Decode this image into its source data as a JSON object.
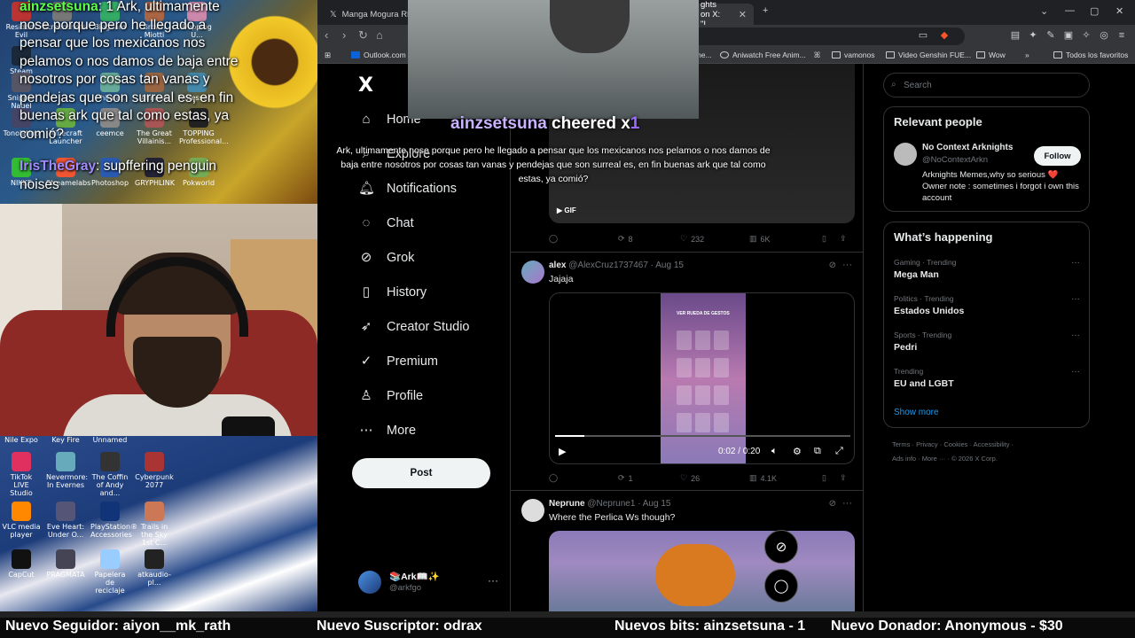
{
  "stream_chat": [
    {
      "user": "ainzsetsuna",
      "sep": ":",
      "prefix_badge": "1",
      "text": "Ark, ultimamente nose porque pero he llegado a pensar que los mexicanos nos pelamos o nos damos de baja entre nosotros por cosas tan vanas y pendejas que son surreal es, en fin buenas ark que tal como estas, ya comió?"
    },
    {
      "user": "IrisTheGray",
      "sep": ":",
      "text": "supffering penguin noises"
    }
  ],
  "desktop_icons_top": [
    "Resident Evil",
    "Screenshots",
    "Bingham",
    "Brown Miotti",
    "Dopping U...",
    "Steam",
    "Snipper Nagel",
    "Phineas",
    "Almond",
    "Professor...",
    "Tonolatino",
    "Minecraft Launcher",
    "ceemce",
    "The Great Villainis...",
    "TOPPING Professional...",
    "NIKKE",
    "Streamelabs",
    "Photoshop",
    "GRYPHLINK",
    "Pokworld"
  ],
  "desktop_icons_bottom": [
    "Nile Expo",
    "Key Fire",
    "Unnamed",
    "TikTok LIVE Studio",
    "Nevermore: In Evernes",
    "The Coffin of Andy and...",
    "Cyberpunk 2077",
    "VLC media player",
    "Eve Heart: Under O...",
    "PlayStation® Accessories",
    "Trails in the Sky 1st C...",
    "CapCut",
    "PRAGMATA",
    "Papelera de reciclaje",
    "atkaudio-pl..."
  ],
  "browser": {
    "tabs": [
      {
        "title": "Manga Mogura RE (A",
        "active": false
      },
      {
        "title": "ghts on X: \"I",
        "active": true
      }
    ],
    "window_controls": [
      "⌄",
      "—",
      "▢",
      "✕"
    ],
    "new_tab": "+",
    "bookmarks": [
      {
        "label": "Outlook.com -"
      },
      {
        "label": "he..."
      },
      {
        "label": "Aniwatch Free Anim..."
      },
      {
        "label": "vamonos"
      },
      {
        "label": "Video Genshin FUE..."
      },
      {
        "label": "Wow"
      },
      {
        "label": "Todos los favoritos"
      }
    ]
  },
  "x": {
    "logo": "X",
    "nav": [
      {
        "label": "Home",
        "icon": "home-icon"
      },
      {
        "label": "Explore",
        "icon": "search-icon"
      },
      {
        "label": "Notifications",
        "icon": "bell-icon"
      },
      {
        "label": "Chat",
        "icon": "chat-icon"
      },
      {
        "label": "Grok",
        "icon": "grok-icon"
      },
      {
        "label": "History",
        "icon": "bookmark-icon"
      },
      {
        "label": "Creator Studio",
        "icon": "rocket-icon"
      },
      {
        "label": "Premium",
        "icon": "verified-icon"
      },
      {
        "label": "Profile",
        "icon": "person-icon"
      },
      {
        "label": "More",
        "icon": "more-circle-icon"
      }
    ],
    "post_button": "Post",
    "account": {
      "name": "📚Ark📖✨",
      "handle": "@arkfgo"
    },
    "gif_label": "GIF",
    "tweets": [
      {
        "reposts": "8",
        "likes": "232",
        "views": "6K"
      },
      {
        "name": "alex",
        "handle": "@AlexCruz1737467",
        "date": "Aug 15",
        "text": "Jajaja",
        "replies": "",
        "reposts": "1",
        "likes": "26",
        "views": "4.1K",
        "video_time": "0:02 / 0:20",
        "video_progress": 0.1,
        "phone_title": "VER RUEDA DE GESTOS"
      },
      {
        "name": "Neprune",
        "handle": "@Neprune1",
        "date": "Aug 15",
        "text": "Where the Perlica Ws though?"
      }
    ],
    "search_placeholder": "Search",
    "relevant_people": {
      "title": "Relevant people",
      "name": "No Context Arknights",
      "handle": "@NoContextArkn",
      "bio": "Arknights Memes,why so serious ❤️ Owner note : sometimes i forgot i own this account",
      "follow": "Follow"
    },
    "happening": {
      "title": "What’s happening",
      "trends": [
        {
          "category": "Gaming · Trending",
          "topic": "Mega Man"
        },
        {
          "category": "Politics · Trending",
          "topic": "Estados Unidos"
        },
        {
          "category": "Sports · Trending",
          "topic": "Pedri"
        },
        {
          "category": "Trending",
          "topic": "EU and LGBT"
        }
      ],
      "show_more": "Show more"
    },
    "footer_line1": "Terms  ·  Privacy  ·  Cookies  ·  Accessibility  ·",
    "footer_line2": "Ads info  ·  More ···  ·  © 2026 X Corp."
  },
  "cheer": {
    "user": "ainzsetsuna",
    "action": "cheered",
    "prefix": "x",
    "count": "1",
    "message": "Ark, ultimamente nose porque pero he llegado a pensar que los mexicanos nos pelamos o nos damos de baja entre nosotros por cosas tan vanas y pendejas que son surreal es, en fin buenas ark que tal como estas, ya comió?"
  },
  "ticker": [
    "Nuevo Seguidor: aiyon__mk_rath",
    "Nuevo Suscriptor: odrax",
    "Nuevos bits: ainzsetsuna - 1",
    "Nuevo Donador: Anonymous - $30"
  ]
}
